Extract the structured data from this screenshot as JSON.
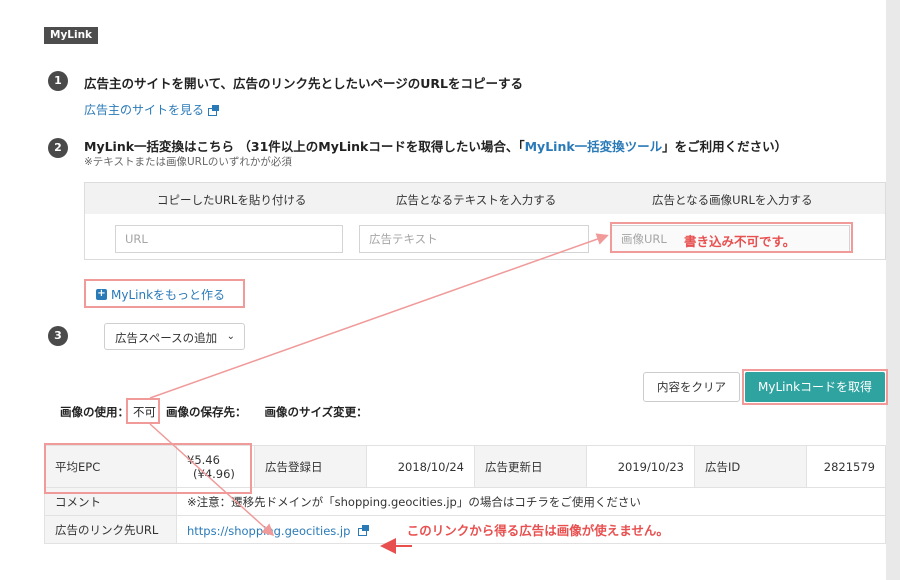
{
  "badge": "MyLink",
  "step1": {
    "num": "1",
    "title": "広告主のサイトを開いて、広告のリンク先としたいページのURLをコピーする",
    "link": "広告主のサイトを見る"
  },
  "step2": {
    "num": "2",
    "title_pre": "MyLink一括変換はこちら （31件以上のMyLinkコードを取得したい場合、「",
    "title_link": "MyLink一括変換ツール",
    "title_post": "」をご利用ください）",
    "note": "※テキストまたは画像URLのいずれかが必須"
  },
  "form": {
    "col_url": "コピーしたURLを貼り付ける",
    "col_text": "広告となるテキストを入力する",
    "col_image": "広告となる画像URLを入力する",
    "url_placeholder": "URL",
    "text_placeholder": "広告テキスト",
    "image_placeholder": "画像URL"
  },
  "annotations": {
    "not_writable": "書き込み不可です。",
    "no_image_ads": "このリンクから得る広告は画像が使えません。"
  },
  "more_button": "MyLinkをもっと作る",
  "step3": {
    "num": "3",
    "select_value": "広告スペースの追加"
  },
  "buttons": {
    "clear": "内容をクリア",
    "get_code": "MyLinkコードを取得"
  },
  "image_info": {
    "usage_label": "画像の使用：",
    "usage_value": "不可",
    "storage_label": "画像の保存先：",
    "resize_label": "画像のサイズ変更："
  },
  "table": {
    "epc_label": "平均EPC",
    "epc_value": "¥5.46",
    "epc_sub": "(¥4.96)",
    "reg_label": "広告登録日",
    "reg_value": "2018/10/24",
    "upd_label": "広告更新日",
    "upd_value": "2019/10/23",
    "id_label": "広告ID",
    "id_value": "2821579",
    "comment_label": "コメント",
    "comment_value": "※注意：遷移先ドメインが「shopping.geocities.jp」の場合はコチラをご使用ください",
    "link_label": "広告のリンク先URL",
    "link_value": "https://shopping.geocities.jp"
  },
  "colors": {
    "link": "#2a7ab8",
    "accent": "#2ea3a0",
    "annotation": "#e85050",
    "annotation_box": "#f09a9a"
  }
}
